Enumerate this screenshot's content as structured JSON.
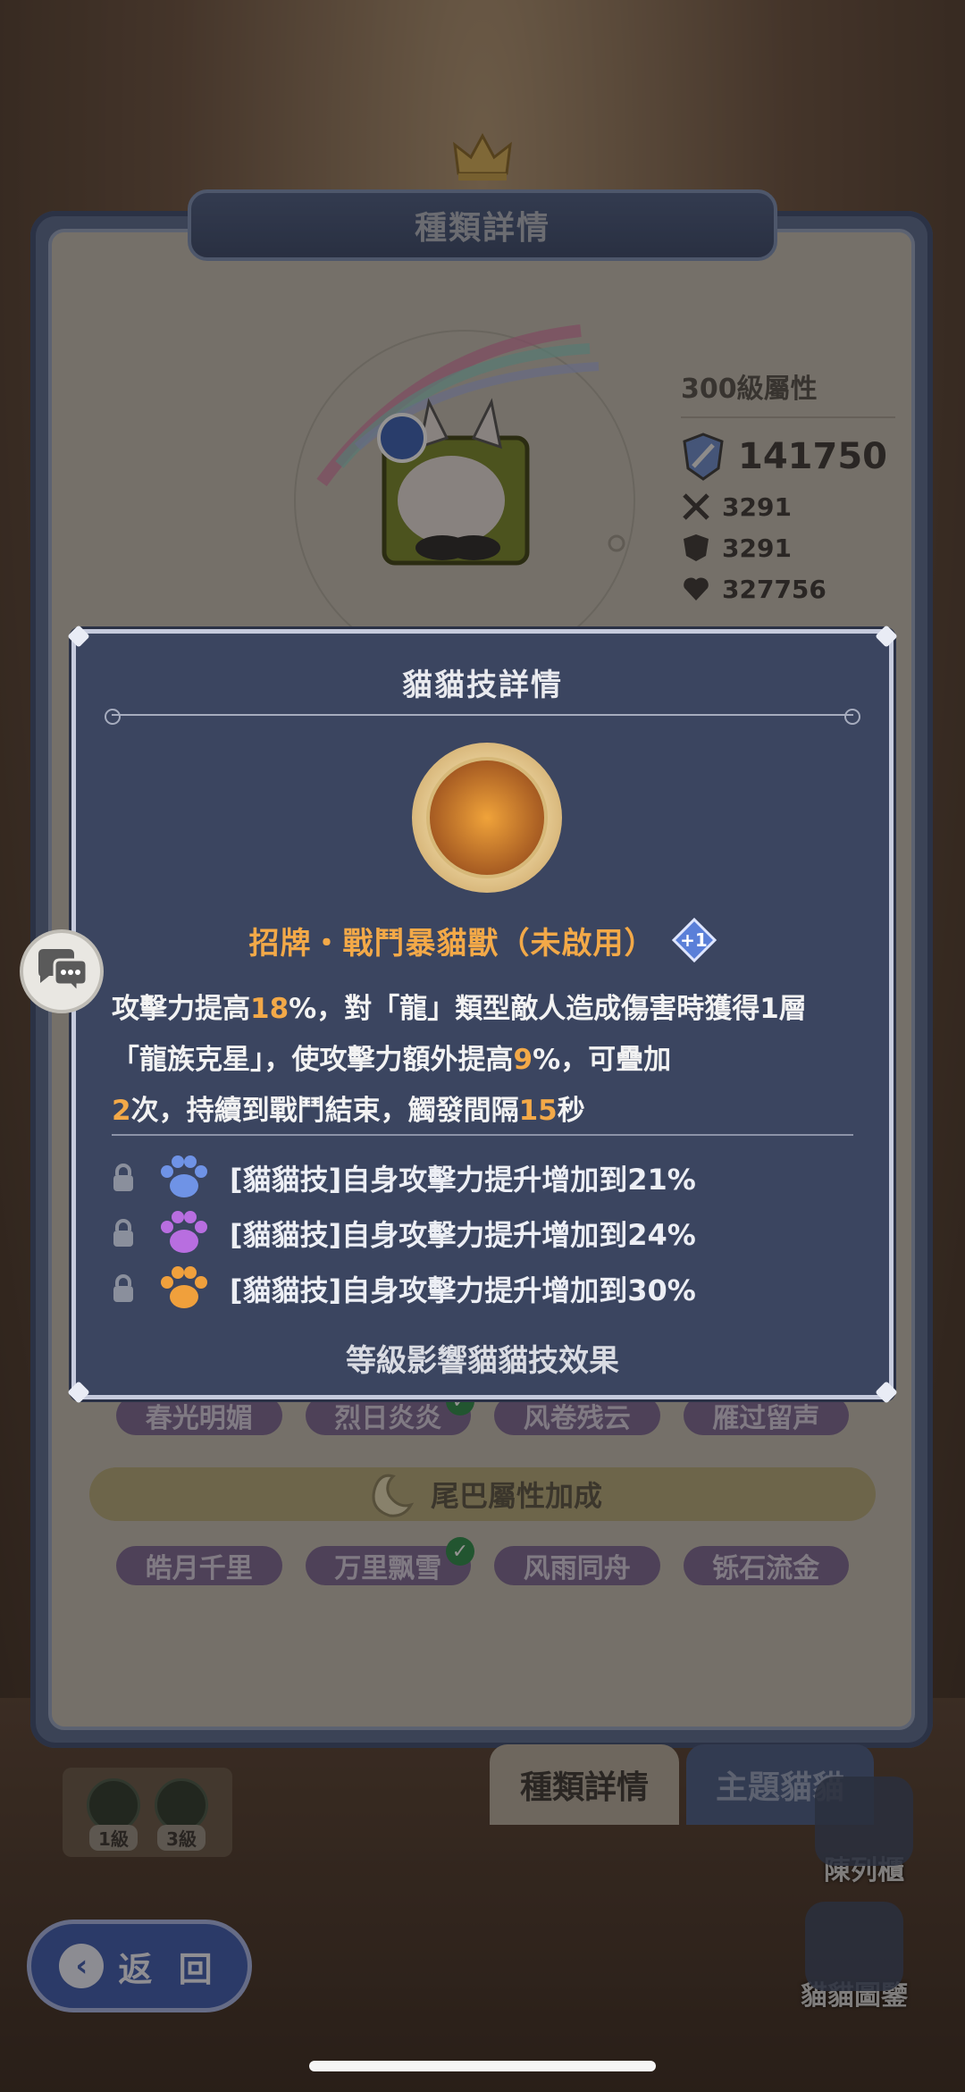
{
  "main": {
    "title": "種類詳情",
    "stats": {
      "title": "300級屬性",
      "power": "141750",
      "attack": "3291",
      "defense": "3291",
      "hp": "327756"
    },
    "tag_row_1": [
      "春光明媚",
      "烈日炎炎",
      "风卷残云",
      "雁过留声"
    ],
    "tail_banner": "尾巴屬性加成",
    "tag_row_2": [
      "皓月千里",
      "万里飘雪",
      "风雨同舟",
      "铄石流金"
    ],
    "levels": [
      "1級",
      "3級"
    ]
  },
  "tabs": [
    "種類詳情",
    "主題貓貓"
  ],
  "side_buttons": {
    "display_cabinet": "陳列櫃",
    "cat_catalog": "貓貓圖鑒"
  },
  "back_button": "返 回",
  "modal": {
    "title": "貓貓技詳情",
    "skill_name": "招牌・戰鬥暴貓獸（未啟用）",
    "plus_badge": "+1",
    "desc": {
      "p1": "攻擊力提高",
      "v1": "18",
      "p2": "%，對「龍」類型敵人造成傷害時獲得1層「龍族克星」，使攻擊力額外提高",
      "v2": "9",
      "p3": "%，可疊加",
      "v3": "2",
      "p4": "次，持續到戰鬥結束，觸發間隔",
      "v4": "15",
      "p5": "秒"
    },
    "bonuses": [
      {
        "text": "[貓貓技]自身攻擊力提升增加到21%",
        "paw_color": "#6f93e6"
      },
      {
        "text": "[貓貓技]自身攻擊力提升增加到24%",
        "paw_color": "#b86ee0"
      },
      {
        "text": "[貓貓技]自身攻擊力提升增加到30%",
        "paw_color": "#f0a03c"
      }
    ],
    "footer": "等級影響貓貓技效果"
  },
  "colors": {
    "highlight": "#f3a948",
    "modal_bg": "#3b4560"
  }
}
